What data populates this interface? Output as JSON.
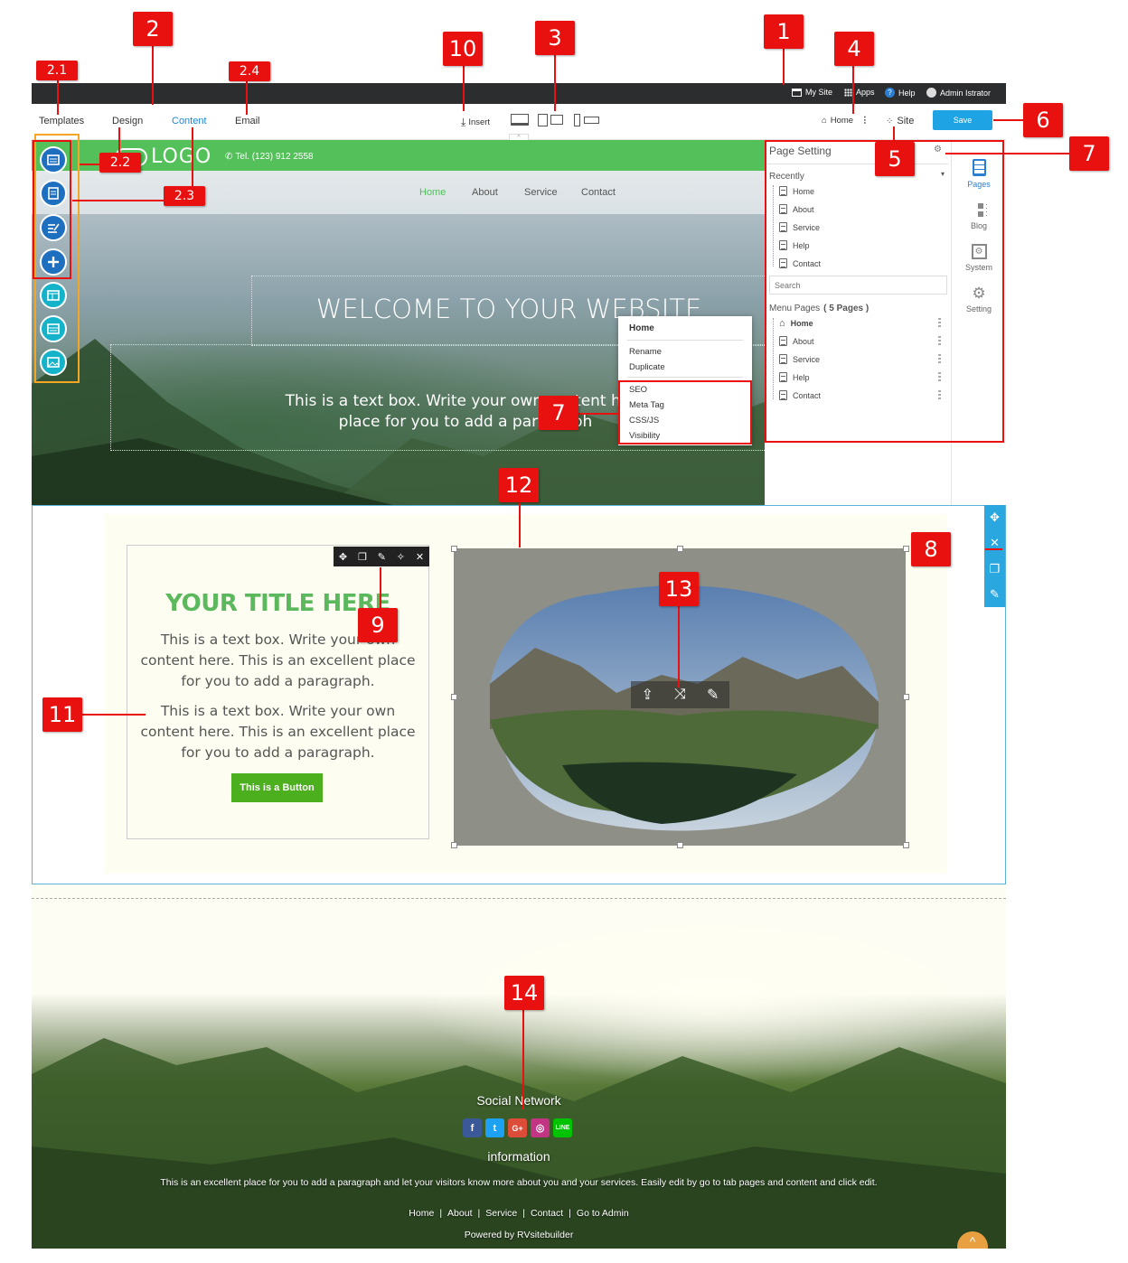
{
  "admin_bar": {
    "my_site": "My Site",
    "apps": "Apps",
    "help": "Help",
    "user": "Admin Istrator"
  },
  "toolbar": {
    "tabs": [
      "Templates",
      "Design",
      "Content",
      "Email"
    ],
    "insert": "Insert",
    "home": "Home",
    "site": "Site",
    "save": "Save"
  },
  "hero": {
    "logo": "LOGO",
    "phone": "Tel. (123) 912 2558",
    "nav": [
      "Home",
      "About",
      "Service",
      "Contact"
    ],
    "headline": "WELCOME TO YOUR WEBSITE",
    "text_line1": "This is a text box. Write your own content here",
    "text_line2": "place for you to add a paragraph"
  },
  "page_setting": {
    "title": "Page Setting",
    "recently_label": "Recently",
    "recently": [
      "Home",
      "About",
      "Service",
      "Help",
      "Contact"
    ],
    "search_placeholder": "Search",
    "menu_label": "Menu Pages",
    "menu_count": "( 5 Pages )",
    "menu": [
      "Home",
      "About",
      "Service",
      "Help",
      "Contact"
    ]
  },
  "side_tabs": [
    "Pages",
    "Blog",
    "System",
    "Setting"
  ],
  "context_menu": {
    "title": "Home",
    "items": [
      "Rename",
      "Duplicate"
    ],
    "seo_items": [
      "SEO",
      "Meta Tag",
      "CSS/JS",
      "Visibility"
    ]
  },
  "section2": {
    "title": "YOUR TITLE HERE",
    "para1": "This is a text box. Write your own content here. This is an excellent place for you to add a paragraph.",
    "para2": "This is a text box. Write your own content here. This is an excellent place for you to add a paragraph.",
    "button": "This is a Button"
  },
  "footer": {
    "social_title": "Social Network",
    "social_icons": [
      "facebook-icon",
      "twitter-icon",
      "google-plus-icon",
      "instagram-icon",
      "line-icon"
    ],
    "info_title": "information",
    "info_text": "This is an excellent place for you to add a paragraph and let your visitors know more about you and your services. Easily edit by go to tab pages and content and click edit.",
    "links": [
      "Home",
      "About",
      "Service",
      "Contact",
      "Go to Admin"
    ],
    "powered": "Powered by RVsitebuilder"
  },
  "callouts": {
    "c1": "1",
    "c2": "2",
    "c21": "2.1",
    "c22": "2.2",
    "c23": "2.3",
    "c24": "2.4",
    "c3": "3",
    "c4": "4",
    "c5": "5",
    "c6": "6",
    "c7a": "7",
    "c7b": "7",
    "c8": "8",
    "c9": "9",
    "c10": "10",
    "c11": "11",
    "c12": "12",
    "c13": "13",
    "c14": "14"
  },
  "colors": {
    "accent_green": "#54c05a",
    "title_green": "#5cb85c",
    "save_blue": "#1ea3e4",
    "callout_red": "#e8110f",
    "admin_bar": "#2b2d2f",
    "round_button_blue": "#1e6fc0",
    "round_button_teal": "#15b3c9"
  }
}
